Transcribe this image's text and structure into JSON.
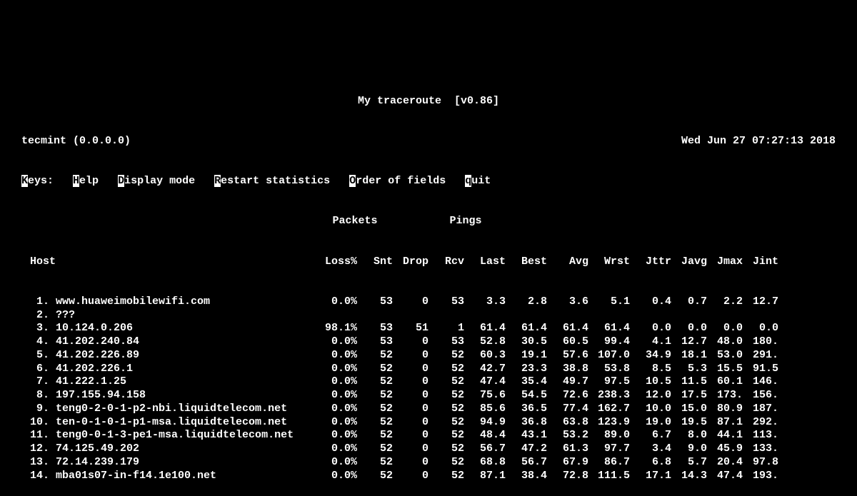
{
  "title_left": "My traceroute",
  "title_right": "[v0.86]",
  "host_line_left": "tecmint (0.0.0.0)",
  "host_line_right": "Wed Jun 27 07:27:13 2018",
  "keys": {
    "label": "Keys:",
    "help_h": "H",
    "help_rest": "elp",
    "disp_d": "D",
    "disp_rest": "isplay mode",
    "restart_r": "R",
    "restart_rest": "estart statistics",
    "order_o": "O",
    "order_rest": "rder of fields",
    "quit_q": "q",
    "quit_rest": "uit"
  },
  "section_packets": "Packets",
  "section_pings": "Pings",
  "columns": {
    "host": "Host",
    "loss": "Loss%",
    "snt": "Snt",
    "drop": "Drop",
    "rcv": "Rcv",
    "last": "Last",
    "best": "Best",
    "avg": "Avg",
    "wrst": "Wrst",
    "jttr": "Jttr",
    "javg": "Javg",
    "jmax": "Jmax",
    "jint": "Jint"
  },
  "hops": [
    {
      "n": " 1.",
      "host": "www.huaweimobilewifi.com",
      "loss": "0.0%",
      "snt": "53",
      "drop": "0",
      "rcv": "53",
      "last": "3.3",
      "best": "2.8",
      "avg": "3.6",
      "wrst": "5.1",
      "jttr": "0.4",
      "javg": "0.7",
      "jmax": "2.2",
      "jint": "12.7",
      "bold": false
    },
    {
      "n": " 2.",
      "host": "???",
      "loss": "",
      "snt": "",
      "drop": "",
      "rcv": "",
      "last": "",
      "best": "",
      "avg": "",
      "wrst": "",
      "jttr": "",
      "javg": "",
      "jmax": "",
      "jint": "",
      "bold": false
    },
    {
      "n": " 3.",
      "host": "10.124.0.206",
      "loss": "98.1%",
      "snt": "53",
      "drop": "51",
      "rcv": "1",
      "last": "61.4",
      "best": "61.4",
      "avg": "61.4",
      "wrst": "61.4",
      "jttr": "0.0",
      "javg": "0.0",
      "jmax": "0.0",
      "jint": "0.0",
      "bold": true
    },
    {
      "n": " 4.",
      "host": "41.202.240.84",
      "loss": "0.0%",
      "snt": "53",
      "drop": "0",
      "rcv": "53",
      "last": "52.8",
      "best": "30.5",
      "avg": "60.5",
      "wrst": "99.4",
      "jttr": "4.1",
      "javg": "12.7",
      "jmax": "48.0",
      "jint": "180.",
      "bold": false
    },
    {
      "n": " 5.",
      "host": "41.202.226.89",
      "loss": "0.0%",
      "snt": "52",
      "drop": "0",
      "rcv": "52",
      "last": "60.3",
      "best": "19.1",
      "avg": "57.6",
      "wrst": "107.0",
      "jttr": "34.9",
      "javg": "18.1",
      "jmax": "53.0",
      "jint": "291.",
      "bold": false
    },
    {
      "n": " 6.",
      "host": "41.202.226.1",
      "loss": "0.0%",
      "snt": "52",
      "drop": "0",
      "rcv": "52",
      "last": "42.7",
      "best": "23.3",
      "avg": "38.8",
      "wrst": "53.8",
      "jttr": "8.5",
      "javg": "5.3",
      "jmax": "15.5",
      "jint": "91.5",
      "bold": false
    },
    {
      "n": " 7.",
      "host": "41.222.1.25",
      "loss": "0.0%",
      "snt": "52",
      "drop": "0",
      "rcv": "52",
      "last": "47.4",
      "best": "35.4",
      "avg": "49.7",
      "wrst": "97.5",
      "jttr": "10.5",
      "javg": "11.5",
      "jmax": "60.1",
      "jint": "146.",
      "bold": false
    },
    {
      "n": " 8.",
      "host": "197.155.94.158",
      "loss": "0.0%",
      "snt": "52",
      "drop": "0",
      "rcv": "52",
      "last": "75.6",
      "best": "54.5",
      "avg": "72.6",
      "wrst": "238.3",
      "jttr": "12.0",
      "javg": "17.5",
      "jmax": "173.",
      "jint": "156.",
      "bold": false
    },
    {
      "n": " 9.",
      "host": "teng0-2-0-1-p2-nbi.liquidtelecom.net",
      "loss": "0.0%",
      "snt": "52",
      "drop": "0",
      "rcv": "52",
      "last": "85.6",
      "best": "36.5",
      "avg": "77.4",
      "wrst": "162.7",
      "jttr": "10.0",
      "javg": "15.0",
      "jmax": "80.9",
      "jint": "187.",
      "bold": false
    },
    {
      "n": "10.",
      "host": "ten-0-1-0-1-p1-msa.liquidtelecom.net",
      "loss": "0.0%",
      "snt": "52",
      "drop": "0",
      "rcv": "52",
      "last": "94.9",
      "best": "36.8",
      "avg": "63.8",
      "wrst": "123.9",
      "jttr": "19.0",
      "javg": "19.5",
      "jmax": "87.1",
      "jint": "292.",
      "bold": false
    },
    {
      "n": "11.",
      "host": "teng0-0-1-3-pe1-msa.liquidtelecom.net",
      "loss": "0.0%",
      "snt": "52",
      "drop": "0",
      "rcv": "52",
      "last": "48.4",
      "best": "43.1",
      "avg": "53.2",
      "wrst": "89.0",
      "jttr": "6.7",
      "javg": "8.0",
      "jmax": "44.1",
      "jint": "113.",
      "bold": false
    },
    {
      "n": "12.",
      "host": "74.125.49.202",
      "loss": "0.0%",
      "snt": "52",
      "drop": "0",
      "rcv": "52",
      "last": "56.7",
      "best": "47.2",
      "avg": "61.3",
      "wrst": "97.7",
      "jttr": "3.4",
      "javg": "9.0",
      "jmax": "45.9",
      "jint": "133.",
      "bold": false
    },
    {
      "n": "13.",
      "host": "72.14.239.179",
      "loss": "0.0%",
      "snt": "52",
      "drop": "0",
      "rcv": "52",
      "last": "68.8",
      "best": "56.7",
      "avg": "67.9",
      "wrst": "86.7",
      "jttr": "6.8",
      "javg": "5.7",
      "jmax": "20.4",
      "jint": "97.8",
      "bold": false
    },
    {
      "n": "14.",
      "host": "mba01s07-in-f14.1e100.net",
      "loss": "0.0%",
      "snt": "52",
      "drop": "0",
      "rcv": "52",
      "last": "87.1",
      "best": "38.4",
      "avg": "72.8",
      "wrst": "111.5",
      "jttr": "17.1",
      "javg": "14.3",
      "jmax": "47.4",
      "jint": "193.",
      "bold": false
    }
  ]
}
